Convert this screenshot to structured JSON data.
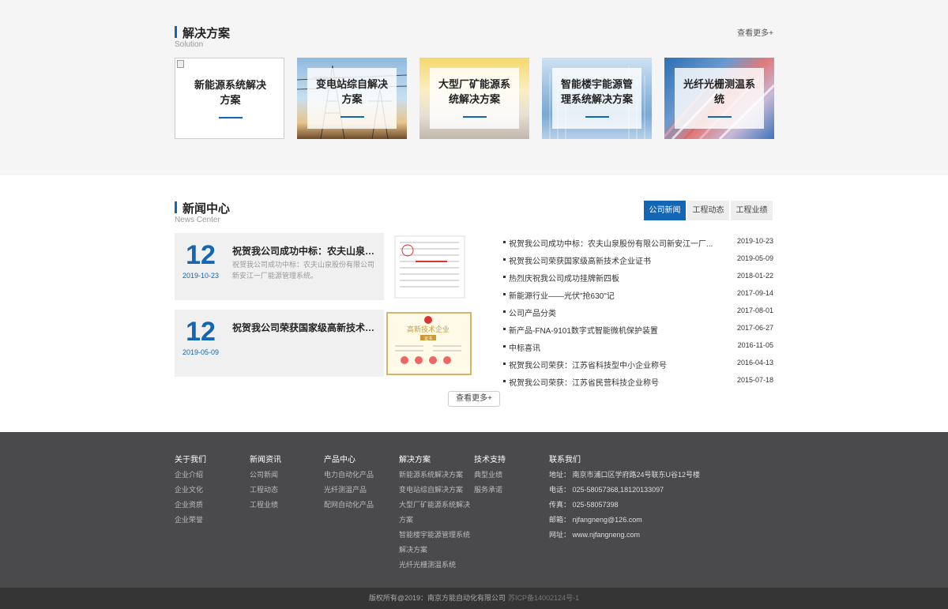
{
  "solutions": {
    "title": "解决方案",
    "subtitle": "Solution",
    "more": "查看更多+",
    "cards": [
      {
        "label": "新能源系统解决方案",
        "line1": "新能源系统解决",
        "line2": "方案"
      },
      {
        "label": "变电站综自解决方案",
        "line1": "变电站综自解决",
        "line2": "方案"
      },
      {
        "label": "大型厂矿能源系统解决方案",
        "line1": "大型厂矿能源系",
        "line2": "统解决方案"
      },
      {
        "label": "智能楼宇能源管理系统解决方案",
        "line1": "智能楼宇能源管",
        "line2": "理系统解决方案"
      },
      {
        "label": "光纤光栅测温系统",
        "line1": "光纤光栅测温系",
        "line2": "统"
      }
    ]
  },
  "news": {
    "title": "新闻中心",
    "subtitle": "News Center",
    "tabs": [
      "公司新闻",
      "工程动态",
      "工程业绩"
    ],
    "active_tab": 0,
    "featured": [
      {
        "day": "12",
        "date": "2019-10-23",
        "title": "祝贺我公司成功中标：农夫山泉股份有限公司新安江一厂能源管理系统",
        "title_display": "祝贺我公司成功中标：农夫山泉股...",
        "desc": "祝贺我公司成功中标：农夫山泉股份有限公司新安江一厂能源管理系统。"
      },
      {
        "day": "12",
        "date": "2019-05-09",
        "title": "祝贺我公司荣获国家级高新技术企业证书",
        "title_display": "祝贺我公司荣获国家级高新技术企...",
        "desc": ""
      }
    ],
    "list": [
      {
        "title": "祝贺我公司成功中标：农夫山泉股份有限公司新安江一厂...",
        "date": "2019-10-23"
      },
      {
        "title": "祝贺我公司荣获国家级高新技术企业证书",
        "date": "2019-05-09"
      },
      {
        "title": "热烈庆祝我公司成功挂牌新四板",
        "date": "2018-01-22"
      },
      {
        "title": "新能源行业——光伏\"抢630\"记",
        "date": "2017-09-14"
      },
      {
        "title": "公司产品分类",
        "date": "2017-08-01"
      },
      {
        "title": "新产品-FNA-9101数字式智能微机保护装置",
        "date": "2017-06-27"
      },
      {
        "title": "中标喜讯",
        "date": "2016-11-05"
      },
      {
        "title": "祝贺我公司荣获：江苏省科技型中小企业称号",
        "date": "2016-04-13"
      },
      {
        "title": "祝贺我公司荣获：江苏省民营科技企业称号",
        "date": "2015-07-18"
      }
    ],
    "more_button": "查看更多+",
    "cert_title": "高新技术企业",
    "cert_sub": "证书"
  },
  "footer": {
    "cols": [
      {
        "head": "关于我们",
        "items": [
          "企业介绍",
          "企业文化",
          "企业资质",
          "企业荣誉"
        ]
      },
      {
        "head": "新闻资讯",
        "items": [
          "公司新闻",
          "工程动态",
          "工程业绩"
        ]
      },
      {
        "head": "产品中心",
        "items": [
          "电力自动化产品",
          "光纤测温产品",
          "配网自动化产品"
        ]
      },
      {
        "head": "解决方案",
        "items": [
          "新能源系统解决方案",
          "变电站综自解决方案",
          "大型厂矿能源系统解决",
          "方案",
          "智能楼宇能源管理系统",
          "解决方案",
          "光纤光栅测温系统"
        ]
      },
      {
        "head": "技术支持",
        "items": [
          "典型业绩",
          "服务承诺"
        ]
      }
    ],
    "contact": {
      "head": "联系我们",
      "address": "地址：  南京市浦口区学府路24号联东U谷12号楼",
      "phone": "电话：  025-58057368,18120133097",
      "fax": "传真：  025-58057398",
      "email": "邮箱：  njfangneng@126.com",
      "web": "网址：  www.njfangneng.com"
    },
    "copyright": "版权所有@2019：南京方能自动化有限公司",
    "icp": "苏ICP备14002124号-1"
  },
  "colors": {
    "accent": "#1366b4",
    "footer_bg": "#4a4a4c",
    "copyright_bg": "#353536"
  }
}
